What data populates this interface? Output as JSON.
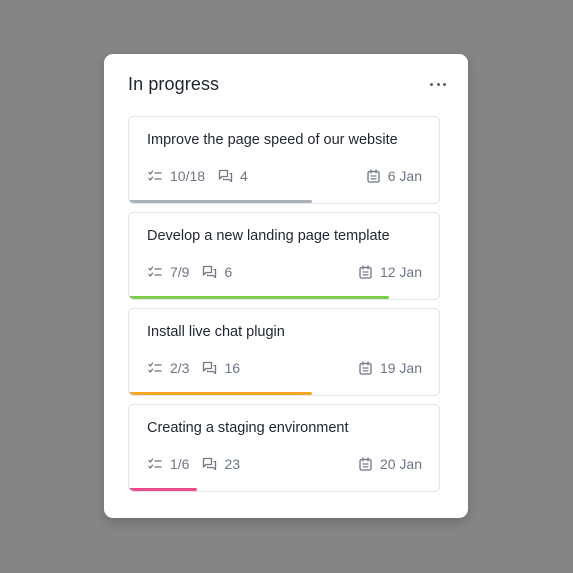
{
  "column": {
    "title": "In progress",
    "more_icon": "more-horizontal-icon"
  },
  "cards": [
    {
      "title": "Improve the page speed of our website",
      "tasks": "10/18",
      "comments": "4",
      "due": "6 Jan",
      "progress": 0.59,
      "progress_color": "#a9b0b8"
    },
    {
      "title": "Develop a new landing page template",
      "tasks": "7/9",
      "comments": "6",
      "due": "12 Jan",
      "progress": 0.84,
      "progress_color": "#7ccd4b"
    },
    {
      "title": "Install live chat plugin",
      "tasks": "2/3",
      "comments": "16",
      "due": "19 Jan",
      "progress": 0.59,
      "progress_color": "#f5a623"
    },
    {
      "title": "Creating a staging environment",
      "tasks": "1/6",
      "comments": "23",
      "due": "20 Jan",
      "progress": 0.22,
      "progress_color": "#ea4d8a"
    }
  ],
  "icons": {
    "tasks": "checklist-icon",
    "comments": "comments-icon",
    "due": "calendar-icon"
  },
  "colors": {
    "background": "#858585",
    "panel": "#ffffff",
    "text": "#1f2530",
    "muted": "#6d7685"
  }
}
